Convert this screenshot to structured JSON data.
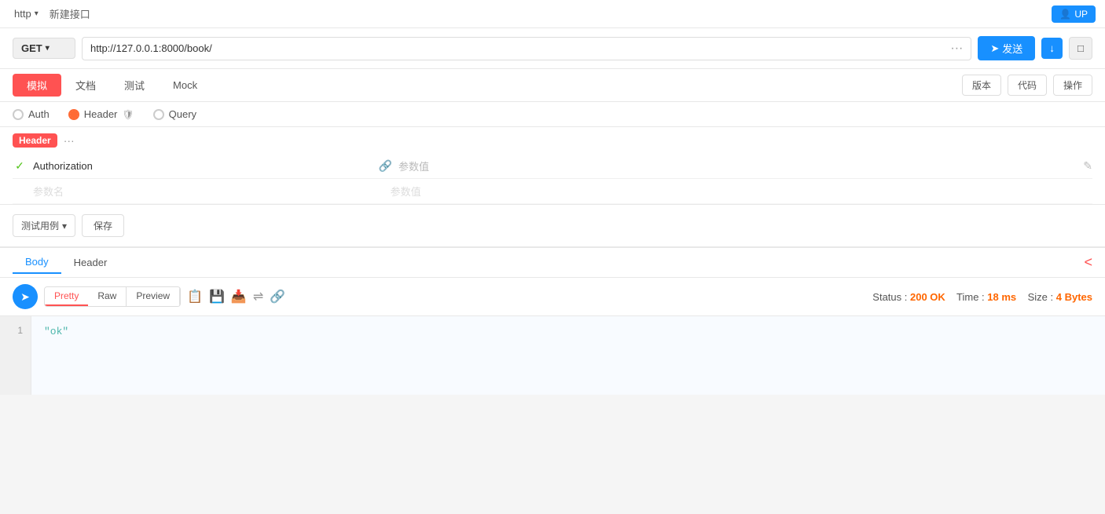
{
  "topbar": {
    "protocol": "http",
    "protocol_arrow": "▾",
    "title": "新建接口",
    "user_btn": "UP"
  },
  "request": {
    "method": "GET",
    "method_arrow": "▾",
    "url": "http://127.0.0.1:8000/book/",
    "more_icon": "···",
    "send_label": "发送",
    "download_icon": "↓",
    "save_icon": "□"
  },
  "tabs": {
    "items": [
      "模拟",
      "文档",
      "测试",
      "Mock"
    ],
    "active": 0,
    "version_label": "版本",
    "code_label": "代码",
    "ops_label": "操作"
  },
  "param_tabs": {
    "auth": "Auth",
    "header": "Header",
    "query": "Query"
  },
  "header_section": {
    "badge": "Header",
    "more": "···",
    "row1": {
      "param_name": "Authorization",
      "link_icon": "🔗",
      "param_value": "参数值",
      "edit_icon": "✎"
    },
    "row2": {
      "param_name": "参数名",
      "param_value": "参数值"
    }
  },
  "actions": {
    "test_case": "测试用例",
    "save": "保存"
  },
  "response": {
    "tabs": [
      "Body",
      "Header"
    ],
    "active_tab": 0,
    "collapse_icon": "<",
    "format_tabs": [
      "Pretty",
      "Raw",
      "Preview"
    ],
    "active_format": 0,
    "status_label": "Status :",
    "status_value": "200 OK",
    "time_label": "Time :",
    "time_value": "18 ms",
    "size_label": "Size :",
    "size_value": "4 Bytes",
    "line_number": "1",
    "code_content": "\"ok\""
  }
}
